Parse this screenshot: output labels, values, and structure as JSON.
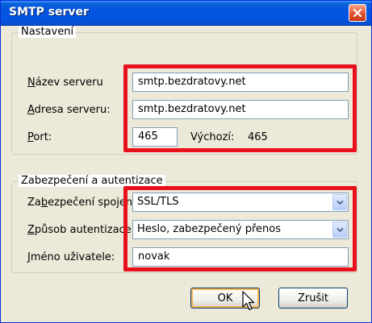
{
  "window": {
    "title": "SMTP server"
  },
  "settings": {
    "legend": "Nastavení",
    "server_name": {
      "label_ul": "N",
      "label_rest": "ázev serveru",
      "value": "smtp.bezdratovy.net"
    },
    "server_address": {
      "label_ul": "A",
      "label_rest": "dresa serveru:",
      "value": "smtp.bezdratovy.net"
    },
    "port": {
      "label_ul": "P",
      "label_rest": "ort:",
      "value": "465",
      "default_label": "Výchozí:",
      "default_value": "465"
    }
  },
  "security": {
    "legend": "Zabezpečení a autentizace",
    "connection": {
      "label_pre": "Za",
      "label_ul": "b",
      "label_rest": "ezpečení spojení:",
      "value": "SSL/TLS"
    },
    "auth_method": {
      "label_ul": "Z",
      "label_rest": "působ autentizace:",
      "value": "Heslo, zabezpečený přenos"
    },
    "username": {
      "label_ul": "J",
      "label_rest": "méno uživatele:",
      "value": "novak"
    }
  },
  "buttons": {
    "ok": "OK",
    "cancel": "Zrušit"
  },
  "colors": {
    "highlight": "#e8111b",
    "titlebar": "#0554e0"
  },
  "icons": {
    "close": "close-icon",
    "dropdown": "chevron-down-icon",
    "cursor": "mouse-pointer-icon"
  }
}
